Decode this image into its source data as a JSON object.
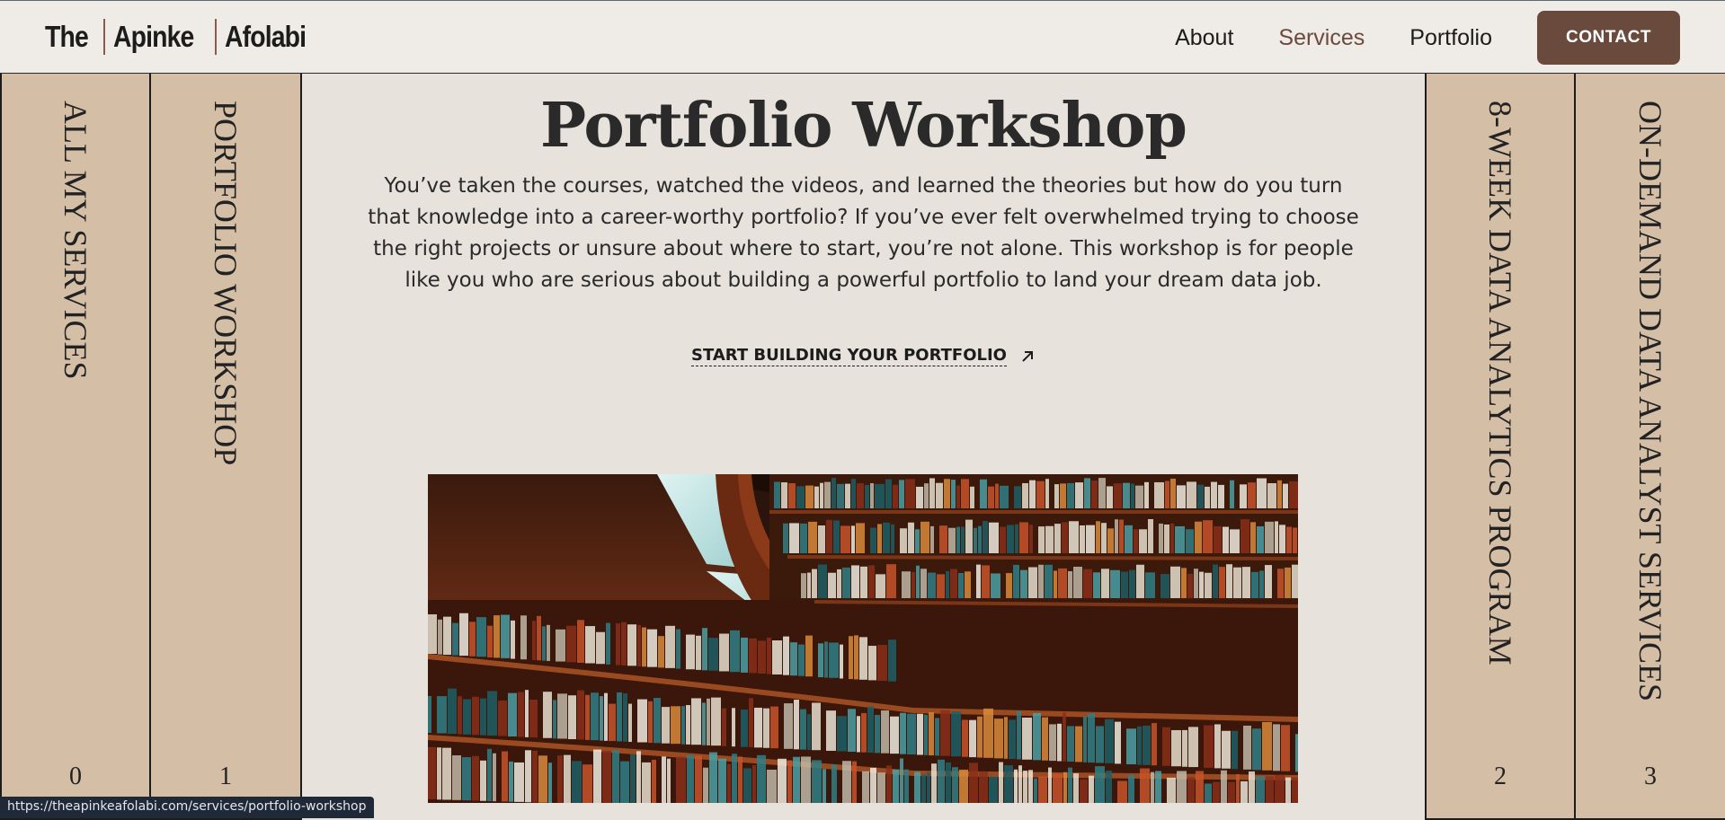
{
  "header": {
    "logo": {
      "part1": "The",
      "part2": "Apinke",
      "part3": "Afolabi"
    },
    "nav": [
      {
        "label": "About",
        "active": false
      },
      {
        "label": "Services",
        "active": true
      },
      {
        "label": "Portfolio",
        "active": false
      }
    ],
    "contact_label": "CONTACT"
  },
  "spines": [
    {
      "title": "ALL MY SERVICES",
      "number": "0"
    },
    {
      "title": "PORTFOLIO WORKSHOP",
      "number": "1"
    },
    {
      "title": "8-WEEK DATA ANALYTICS PROGRAM",
      "number": "2"
    },
    {
      "title": "ON-DEMAND DATA ANALYST SERVICES",
      "number": "3"
    }
  ],
  "main": {
    "title": "Portfolio Workshop",
    "intro": "You’ve taken the courses, watched the videos, and learned the theories but how do you turn that knowledge into a career-worthy portfolio? If you’ve ever felt overwhelmed trying to choose the right projects or unsure about where to start, you’re not alone. This workshop is for people like you who are serious about building a powerful portfolio to land your dream data job.",
    "cta_label": "START BUILDING YOUR PORTFOLIO",
    "cta_icon": "arrow-up-right-icon",
    "image_subject": "library-bookshelves-image"
  },
  "status_bar": {
    "url": "https://theapinkeafolabi.com/services/portfolio-workshop"
  },
  "colors": {
    "accent": "#6b4a3e",
    "spine": "#d4bea6",
    "background": "#efece8",
    "main_bg": "#e7e2dc"
  }
}
